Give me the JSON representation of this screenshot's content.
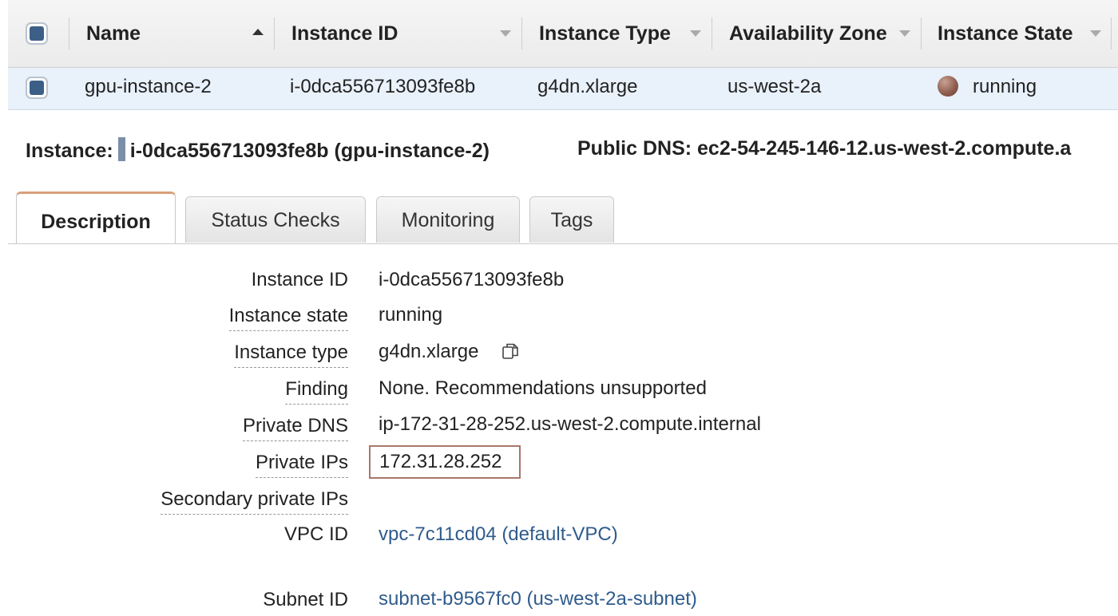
{
  "table": {
    "columns": [
      {
        "label": "Name",
        "sort": "asc"
      },
      {
        "label": "Instance ID",
        "sort": "none"
      },
      {
        "label": "Instance Type",
        "sort": "none"
      },
      {
        "label": "Availability Zone",
        "sort": "none"
      },
      {
        "label": "Instance State",
        "sort": "none"
      }
    ],
    "rows": [
      {
        "name": "gpu-instance-2",
        "instance_id": "i-0dca556713093fe8b",
        "instance_type": "g4dn.xlarge",
        "availability_zone": "us-west-2a",
        "state": "running",
        "state_color": "#8b5a4a"
      }
    ]
  },
  "summary": {
    "instance_label": "Instance:",
    "instance_value": "i-0dca556713093fe8b (gpu-instance-2)",
    "dns_label": "Public DNS:",
    "dns_value": "ec2-54-245-146-12.us-west-2.compute.a"
  },
  "tabs": [
    {
      "label": "Description",
      "active": true
    },
    {
      "label": "Status Checks",
      "active": false
    },
    {
      "label": "Monitoring",
      "active": false
    },
    {
      "label": "Tags",
      "active": false
    }
  ],
  "details": {
    "instance_id": {
      "label": "Instance ID",
      "value": "i-0dca556713093fe8b"
    },
    "instance_state": {
      "label": "Instance state",
      "value": "running"
    },
    "instance_type": {
      "label": "Instance type",
      "value": "g4dn.xlarge"
    },
    "finding": {
      "label": "Finding",
      "value": "None. Recommendations unsupported"
    },
    "private_dns": {
      "label": "Private DNS",
      "value": "ip-172-31-28-252.us-west-2.compute.internal"
    },
    "private_ips": {
      "label": "Private IPs",
      "value": "172.31.28.252"
    },
    "secondary_private_ips": {
      "label": "Secondary private IPs",
      "value": ""
    },
    "vpc_id": {
      "label": "VPC ID",
      "value": "vpc-7c11cd04 (default-VPC)"
    },
    "subnet_id": {
      "label": "Subnet ID",
      "value": "subnet-b9567fc0 (us-west-2a-subnet)"
    }
  },
  "colors": {
    "link": "#2f5b8c",
    "highlight_box": "#a8776a",
    "selected_row": "#e9f1fb",
    "checkbox_fill": "#3c5f87"
  }
}
